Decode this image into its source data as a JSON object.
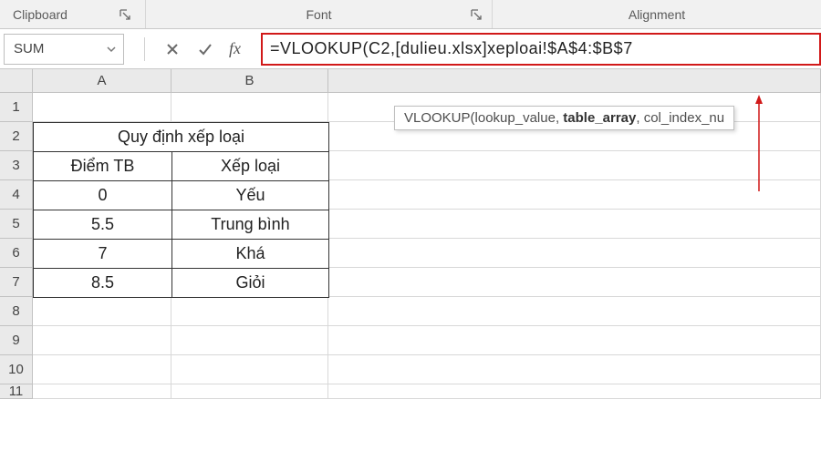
{
  "ribbon": {
    "clipboard_label": "Clipboard",
    "font_label": "Font",
    "alignment_label": "Alignment"
  },
  "namebox": {
    "value": "SUM"
  },
  "fxbar": {
    "cancel_icon": "close-icon",
    "confirm_icon": "check-icon",
    "fx_label": "fx",
    "formula": "=VLOOKUP(C2,[dulieu.xlsx]xeploai!$A$4:$B$7"
  },
  "syntax_hint": {
    "fn": "VLOOKUP",
    "parts": [
      "lookup_value",
      "table_array",
      "col_index_nu"
    ],
    "bold_index": 1
  },
  "grid": {
    "columns": [
      "A",
      "B"
    ],
    "row_numbers": [
      1,
      2,
      3,
      4,
      5,
      6,
      7,
      8,
      9,
      10,
      11
    ]
  },
  "table": {
    "title": "Quy định xếp loại",
    "headers": [
      "Điểm TB",
      "Xếp loại"
    ],
    "rows": [
      [
        "0",
        "Yếu"
      ],
      [
        "5.5",
        "Trung bình"
      ],
      [
        "7",
        "Khá"
      ],
      [
        "8.5",
        "Giỏi"
      ]
    ]
  }
}
